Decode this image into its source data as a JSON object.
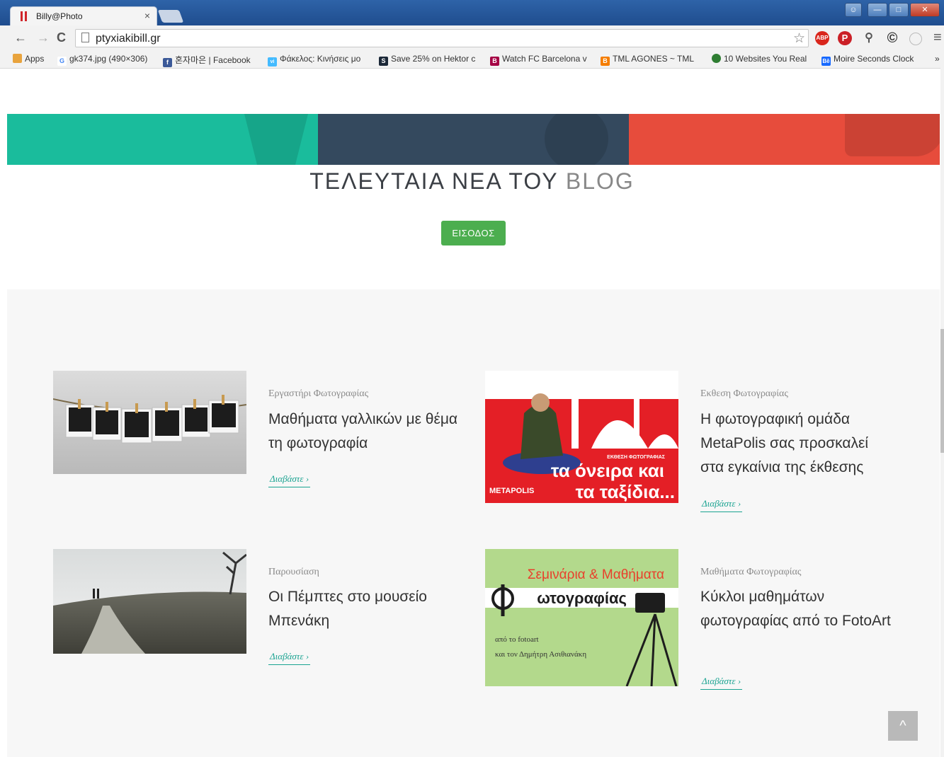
{
  "browser": {
    "tab_title": "Billy@Photo",
    "tab_close": "×",
    "url": "ptyxiakibill.gr",
    "nav": {
      "back": "←",
      "forward": "→",
      "reload": "C"
    },
    "star": "☆",
    "menu": "≡",
    "extensions": [
      {
        "name": "adblock-plus-icon",
        "label": "ABP",
        "color": "#d9261c"
      },
      {
        "name": "pinterest-icon",
        "label": "P",
        "color": "#cb2027"
      },
      {
        "name": "microscope-icon",
        "label": "",
        "color": "#666666"
      },
      {
        "name": "copyright-icon",
        "label": "©",
        "color": "#333333"
      },
      {
        "name": "ghost-icon",
        "label": "",
        "color": "#bbbbbb"
      }
    ]
  },
  "bookmarks": {
    "items": [
      {
        "label": "Apps",
        "icon": "apps-grid-icon",
        "color": "#e44d26"
      },
      {
        "label": "gk374.jpg (490×306)",
        "icon": "google-icon",
        "color": "#4285f4"
      },
      {
        "label": "혼자마은 | Facebook",
        "icon": "facebook-icon",
        "color": "#3b5998"
      },
      {
        "label": "Φάκελος: Κινήσεις μο",
        "icon": "vimeo-icon",
        "color": "#44bbff"
      },
      {
        "label": "Save 25% on Hektor c",
        "icon": "steam-icon",
        "color": "#1b2838"
      },
      {
        "label": "Watch FC Barcelona v",
        "icon": "barcelona-icon",
        "color": "#a50044"
      },
      {
        "label": "TML AGONES ~ TML",
        "icon": "blogger-icon",
        "color": "#f57d00"
      },
      {
        "label": "10 Websites You Real",
        "icon": "green-dot-icon",
        "color": "#2e7d32"
      },
      {
        "label": "Moire Seconds Clock",
        "icon": "behance-icon",
        "color": "#1769ff"
      }
    ],
    "more": "»"
  },
  "banner": {
    "colors": [
      "#1abc9c",
      "#34495e",
      "#e74c3c"
    ]
  },
  "blog": {
    "title_bold": "ΤΕΛΕΥΤΑΙΑ ΝΕΑ ΤΟΥ",
    "title_light": "BLOG",
    "enter_label": "ΕΙΣΟΔΟΣ"
  },
  "posts": [
    {
      "category": "Εργαστήρι Φωτογραφίας",
      "title": "Μαθήματα γαλλικών με θέμα τη φωτογραφία",
      "read_more": "Διαβάστε ›",
      "image": "polaroids-on-string-photo"
    },
    {
      "category": "Εκθεση Φωτογραφίας",
      "title": "Η φωτογραφική ομάδα MetaPolis σας προσκαλεί στα εγκαίνια της έκθεσης",
      "read_more": "Διαβάστε ›",
      "image": "metapolis-exhibition-poster",
      "poster": {
        "line1": "ΕΚΘΕΣΗ ΦΩΤΟΓΡΑΦΙΑΣ",
        "line2": "τα όνειρα και",
        "line3": "τα ταξίδια...",
        "brand": "METAPOLIS"
      }
    },
    {
      "category": "Παρουσίαση",
      "title": "Οι Πέμπτες στο μουσείο Μπενάκη",
      "read_more": "Διαβάστε ›",
      "image": "path-landscape-photo"
    },
    {
      "category": "Μαθήματα Φωτογραφίας",
      "title": "Κύκλοι μαθημάτων φωτογραφίας από το FotoArt",
      "read_more": "Διαβάστε ›",
      "image": "seminars-poster",
      "poster": {
        "line1": "Σεμινάρια & Μαθήματα",
        "line2": "ωτογραφίας",
        "line3": "από το fotoart",
        "line4": "και τον Δημήτρη Ασιθιανάκη"
      }
    }
  ],
  "scroll_top_label": "^"
}
